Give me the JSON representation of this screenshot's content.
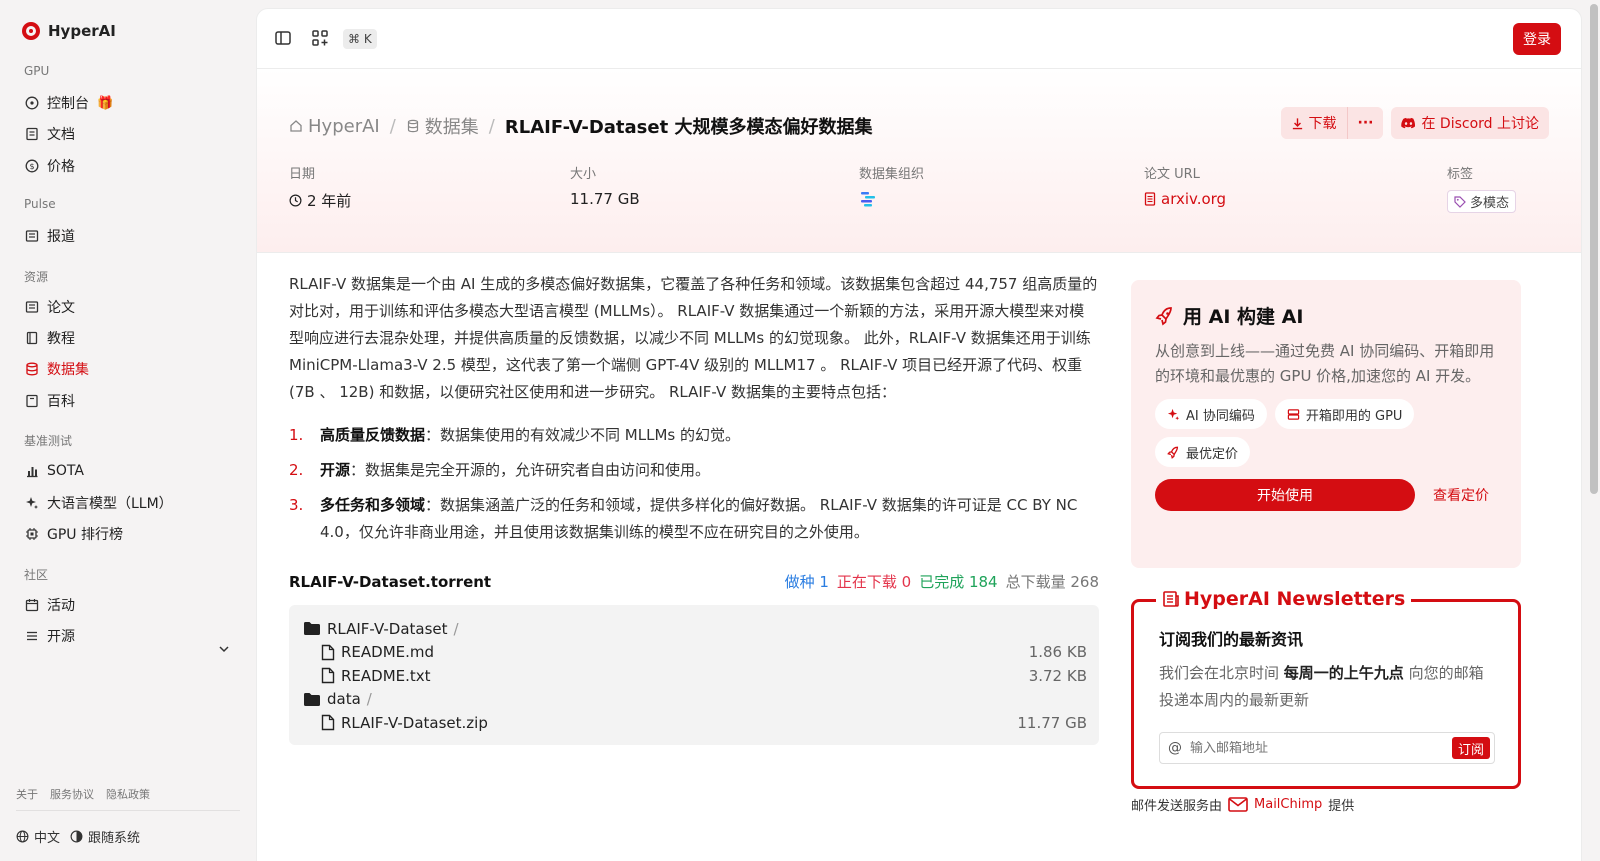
{
  "app": {
    "name": "HyperAI"
  },
  "sidebar": {
    "sections": [
      {
        "title": "GPU",
        "items": [
          {
            "label": "控制台",
            "icon": "compass-icon"
          },
          {
            "label": "文档",
            "icon": "doc-icon"
          },
          {
            "label": "价格",
            "icon": "dollar-icon"
          }
        ]
      },
      {
        "title": "Pulse",
        "items": [
          {
            "label": "报道",
            "icon": "newspaper-icon"
          }
        ]
      },
      {
        "title": "资源",
        "items": [
          {
            "label": "论文",
            "icon": "paper-icon"
          },
          {
            "label": "教程",
            "icon": "book-icon"
          },
          {
            "label": "数据集",
            "icon": "database-icon",
            "active": true
          },
          {
            "label": "百科",
            "icon": "encyclopedia-icon"
          }
        ]
      },
      {
        "title": "基准测试",
        "items": [
          {
            "label": "SOTA",
            "icon": "bar-chart-icon"
          },
          {
            "label": "大语言模型（LLM）",
            "icon": "sparkle-icon"
          },
          {
            "label": "GPU 排行榜",
            "icon": "chip-icon"
          }
        ]
      },
      {
        "title": "社区",
        "items": [
          {
            "label": "活动",
            "icon": "calendar-icon"
          },
          {
            "label": "开源",
            "icon": "list-filter-icon"
          }
        ]
      }
    ],
    "footer_links": [
      "关于",
      "服务协议",
      "隐私政策"
    ],
    "language": "中文",
    "theme": "跟随系统"
  },
  "topbar": {
    "shortcut": "⌘ K",
    "login_label": "登录"
  },
  "breadcrumb": {
    "home": "HyperAI",
    "section": "数据集",
    "current": "RLAIF-V-Dataset 大规模多模态偏好数据集"
  },
  "actions": {
    "download": "下载",
    "more": "···",
    "discord": "在 Discord 上讨论"
  },
  "meta": {
    "date_label": "日期",
    "date_value": "2 年前",
    "size_label": "大小",
    "size_value": "11.77 GB",
    "org_label": "数据集组织",
    "url_label": "论文 URL",
    "url_value": "arxiv.org",
    "tags_label": "标签",
    "tag_value": "多模态"
  },
  "description": "RLAIF-V 数据集是一个由 AI 生成的多模态偏好数据集，它覆盖了各种任务和领域。该数据集包含超过 44,757 组高质量的对比对，用于训练和评估多模态大型语言模型 (MLLMs）。 RLAIF-V 数据集通过一个新颖的方法，采用开源大模型来对模型响应进行去混杂处理，并提供高质量的反馈数据，以减少不同 MLLMs 的幻觉现象。 此外，RLAIF-V 数据集还用于训练 MiniCPM-Llama3-V 2.5 模型，这代表了第一个端侧 GPT-4V 级别的 MLLM17 。 RLAIF-V 项目已经开源了代码、权重 (7B 、 12B) 和数据，以便研究社区使用和进一步研究。 RLAIF-V 数据集的主要特点包括：",
  "features": [
    {
      "num": "1.",
      "bold": "高质量反馈数据",
      "text": "：数据集使用的有效减少不同 MLLMs 的幻觉。"
    },
    {
      "num": "2.",
      "bold": "开源",
      "text": "：数据集是完全开源的，允许研究者自由访问和使用。"
    },
    {
      "num": "3.",
      "bold": "多任务和多领域",
      "text": "：数据集涵盖广泛的任务和领域，提供多样化的偏好数据。 RLAIF-V 数据集的许可证是 CC BY NC 4.0，仅允许非商业用途，并且使用该数据集训练的模型不应在研究目的之外使用。"
    }
  ],
  "torrent": {
    "title": "RLAIF-V-Dataset.torrent",
    "seeding": "做种 1",
    "downloading": "正在下载 0",
    "completed": "已完成 184",
    "total": "总下载量 268",
    "files": [
      {
        "name": "RLAIF-V-Dataset",
        "suffix": "/",
        "type": "folder",
        "size": ""
      },
      {
        "name": "README.md",
        "suffix": "",
        "type": "file",
        "size": "1.86 KB"
      },
      {
        "name": "README.txt",
        "suffix": "",
        "type": "file",
        "size": "3.72 KB"
      },
      {
        "name": "data",
        "suffix": "/",
        "type": "folder",
        "size": ""
      },
      {
        "name": "RLAIF-V-Dataset.zip",
        "suffix": "",
        "type": "file",
        "size": "11.77 GB"
      }
    ]
  },
  "promo": {
    "title": "用 AI 构建 AI",
    "desc": "从创意到上线——通过免费 AI 协同编码、开箱即用的环境和最优惠的 GPU 价格,加速您的 AI 开发。",
    "chips": [
      "AI 协同编码",
      "开箱即用的 GPU",
      "最优定价"
    ],
    "start_label": "开始使用",
    "pricing_label": "查看定价"
  },
  "newsletter": {
    "title": "HyperAI Newsletters",
    "subtitle": "订阅我们的最新资讯",
    "desc_pre": "我们会在北京时间 ",
    "desc_bold": "每周一的上午九点",
    "desc_post": " 向您的邮箱投递本周内的最新更新",
    "email_placeholder": "输入邮箱地址",
    "subscribe_label": "订阅",
    "provider_pre": "邮件发送服务由",
    "provider_name": "MailChimp",
    "provider_post": "提供"
  },
  "colors": {
    "accent": "#d40d12",
    "seeding": "#2a7de1",
    "downloading": "#e3344b",
    "completed": "#1fa35a"
  }
}
